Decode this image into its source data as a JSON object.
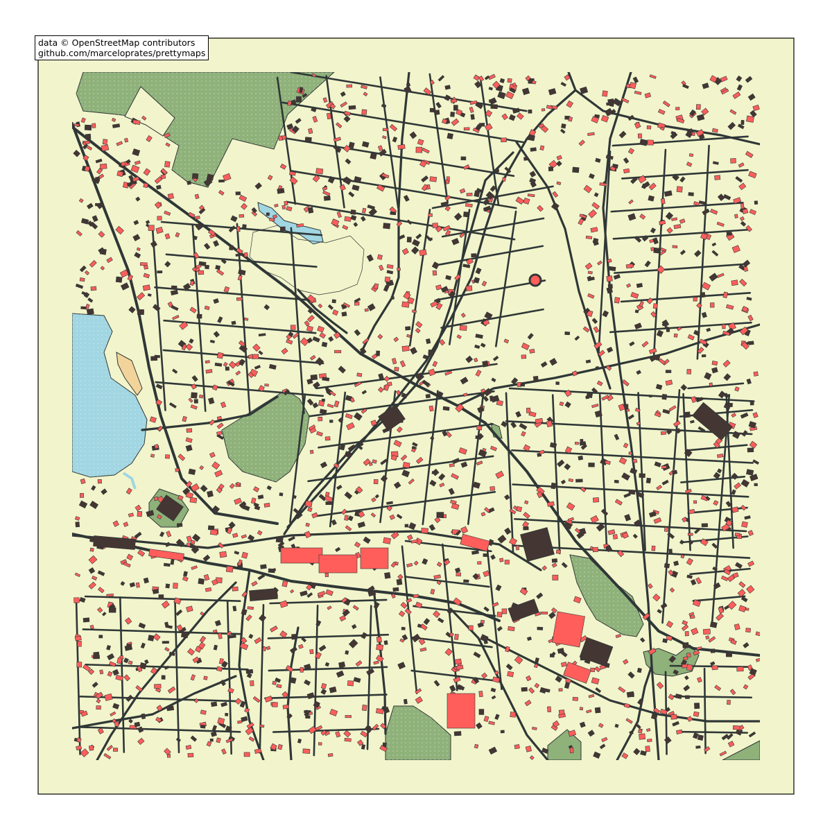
{
  "attribution": {
    "line1": "data © OpenStreetMap contributors",
    "line2": "github.com/marceloprates/prettymaps"
  },
  "colors": {
    "background": "#f2f4cb",
    "frame": "#000000",
    "street": "#2f3737",
    "building_a": "#433633",
    "building_b": "#ff5e5b",
    "park": "#8fb17a",
    "water": "#a1d6e2",
    "sand": "#f2d49b",
    "outline": "#2f3737"
  },
  "layers": [
    "streets",
    "buildings",
    "parks",
    "water",
    "sand"
  ]
}
